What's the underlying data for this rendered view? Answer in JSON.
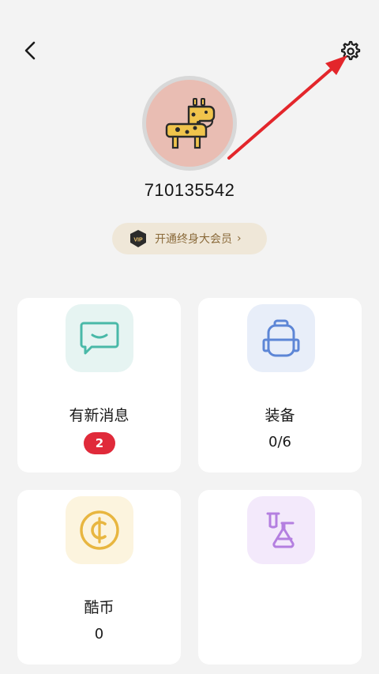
{
  "header": {
    "back_icon": "chevron-left-icon",
    "settings_icon": "gear-icon"
  },
  "profile": {
    "avatar_icon": "giraffe-icon",
    "avatar_bg": "#e9bdb3",
    "user_id": "710135542"
  },
  "vip": {
    "badge_text": "VIP",
    "label": "开通终身大会员",
    "chevron": "›",
    "text_color": "#8a6a3a"
  },
  "cards": {
    "messages": {
      "title": "有新消息",
      "badge": "2",
      "icon": "chat-icon",
      "accent": "#49b9a8"
    },
    "equipment": {
      "title": "装备",
      "value": "0/6",
      "icon": "backpack-icon",
      "accent": "#5d86d6"
    },
    "coins": {
      "title": "酷币",
      "value": "0",
      "icon": "coin-icon",
      "accent": "#e8b640"
    },
    "lab": {
      "icon": "flask-icon",
      "accent": "#b47fe0"
    }
  },
  "annotation": {
    "arrow_color": "#e3262b"
  }
}
